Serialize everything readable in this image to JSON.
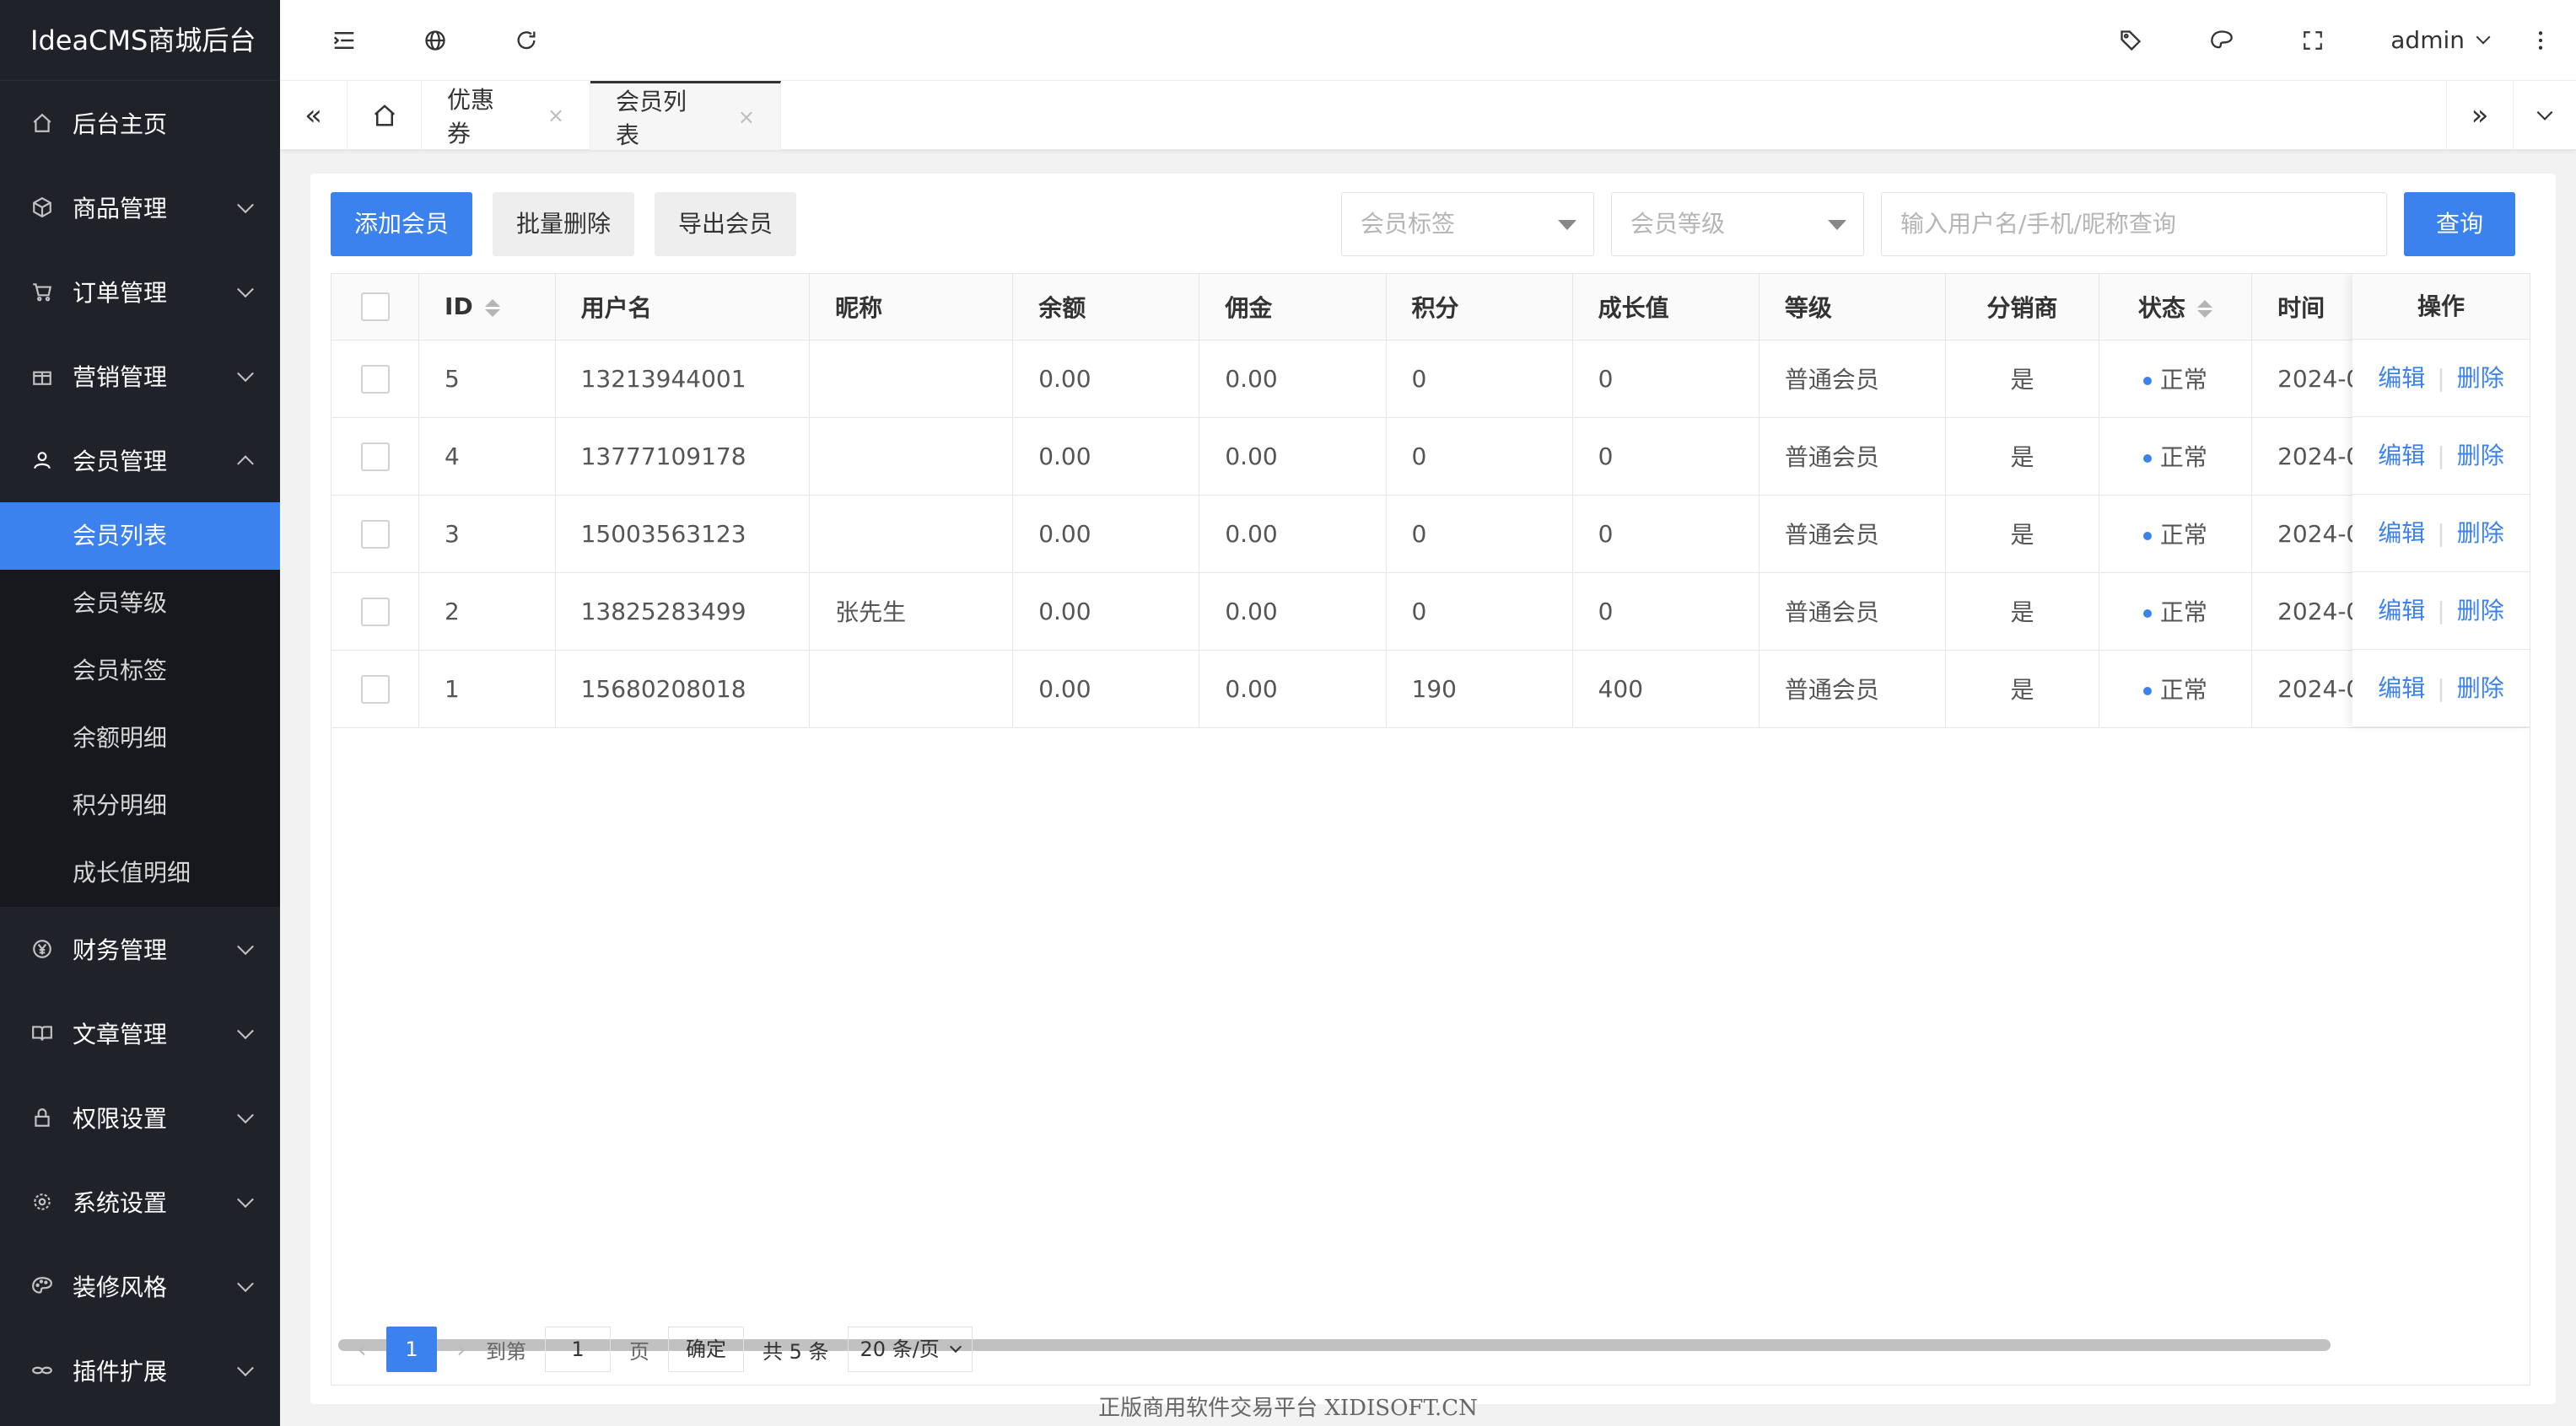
{
  "app": {
    "title": "IdeaCMS商城后台"
  },
  "sidebar": {
    "items": [
      {
        "label": "后台主页",
        "icon": "home-icon"
      },
      {
        "label": "商品管理",
        "icon": "cube-icon"
      },
      {
        "label": "订单管理",
        "icon": "cart-icon"
      },
      {
        "label": "营销管理",
        "icon": "gift-icon"
      },
      {
        "label": "会员管理",
        "icon": "user-icon",
        "expanded": true
      },
      {
        "label": "财务管理",
        "icon": "yen-icon"
      },
      {
        "label": "文章管理",
        "icon": "book-icon"
      },
      {
        "label": "权限设置",
        "icon": "lock-icon"
      },
      {
        "label": "系统设置",
        "icon": "gear-icon"
      },
      {
        "label": "装修风格",
        "icon": "palette-icon"
      },
      {
        "label": "插件扩展",
        "icon": "link-icon"
      }
    ],
    "submenu": [
      {
        "label": "会员列表",
        "active": true
      },
      {
        "label": "会员等级"
      },
      {
        "label": "会员标签"
      },
      {
        "label": "余额明细"
      },
      {
        "label": "积分明细"
      },
      {
        "label": "成长值明细"
      }
    ]
  },
  "header": {
    "user": "admin",
    "icons": [
      "menu-toggle-icon",
      "globe-icon",
      "refresh-icon",
      "tag-icon",
      "theme-icon",
      "fullscreen-icon",
      "more-icon"
    ]
  },
  "tabs": {
    "items": [
      {
        "label": "优惠券"
      },
      {
        "label": "会员列表",
        "active": true
      }
    ],
    "close": "×"
  },
  "toolbar": {
    "add": "添加会员",
    "batch_delete": "批量删除",
    "export": "导出会员",
    "tag_select_placeholder": "会员标签",
    "level_select_placeholder": "会员等级",
    "search_placeholder": "输入用户名/手机/昵称查询",
    "query": "查询"
  },
  "table": {
    "columns": [
      "ID",
      "用户名",
      "昵称",
      "余额",
      "佣金",
      "积分",
      "成长值",
      "等级",
      "分销商",
      "状态",
      "时间",
      "操作"
    ],
    "rows": [
      {
        "id": "5",
        "username": "13213944001",
        "nickname": "",
        "balance": "0.00",
        "commission": "0.00",
        "points": "0",
        "growth": "0",
        "level": "普通会员",
        "distributor": "是",
        "status": "正常",
        "time": "2024-0"
      },
      {
        "id": "4",
        "username": "13777109178",
        "nickname": "",
        "balance": "0.00",
        "commission": "0.00",
        "points": "0",
        "growth": "0",
        "level": "普通会员",
        "distributor": "是",
        "status": "正常",
        "time": "2024-0"
      },
      {
        "id": "3",
        "username": "15003563123",
        "nickname": "",
        "balance": "0.00",
        "commission": "0.00",
        "points": "0",
        "growth": "0",
        "level": "普通会员",
        "distributor": "是",
        "status": "正常",
        "time": "2024-0"
      },
      {
        "id": "2",
        "username": "13825283499",
        "nickname": "张先生",
        "balance": "0.00",
        "commission": "0.00",
        "points": "0",
        "growth": "0",
        "level": "普通会员",
        "distributor": "是",
        "status": "正常",
        "time": "2024-0"
      },
      {
        "id": "1",
        "username": "15680208018",
        "nickname": "",
        "balance": "0.00",
        "commission": "0.00",
        "points": "190",
        "growth": "400",
        "level": "普通会员",
        "distributor": "是",
        "status": "正常",
        "time": "2024-0"
      }
    ],
    "edit": "编辑",
    "delete": "删除",
    "sep": "|"
  },
  "pagination": {
    "current": "1",
    "goto_label": "到第",
    "goto_value": "1",
    "page_label": "页",
    "confirm": "确定",
    "total": "共 5 条",
    "page_size": "20 条/页"
  },
  "watermark": "正版商用软件交易平台 XIDISOFT.CN",
  "colors": {
    "primary": "#3b82ee",
    "sidebar": "#20222a"
  }
}
